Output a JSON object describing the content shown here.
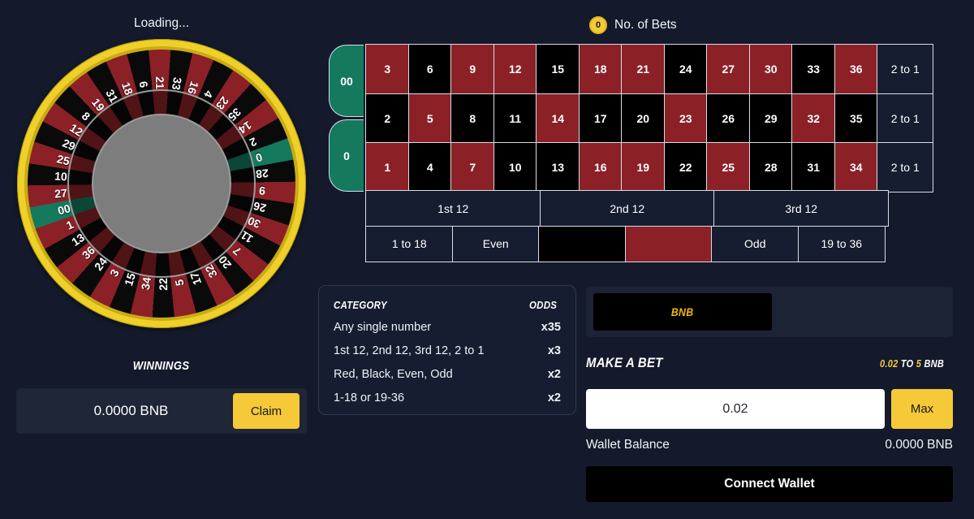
{
  "status": {
    "loading_text": "Loading..."
  },
  "bets_badge": {
    "count": "0",
    "label": "No. of Bets"
  },
  "board": {
    "zeros": [
      {
        "label": "00"
      },
      {
        "label": "0"
      }
    ],
    "rows": [
      {
        "cells": [
          {
            "label": "3",
            "color": "red"
          },
          {
            "label": "6",
            "color": "black"
          },
          {
            "label": "9",
            "color": "red"
          },
          {
            "label": "12",
            "color": "red"
          },
          {
            "label": "15",
            "color": "black"
          },
          {
            "label": "18",
            "color": "red"
          },
          {
            "label": "21",
            "color": "red"
          },
          {
            "label": "24",
            "color": "black"
          },
          {
            "label": "27",
            "color": "red"
          },
          {
            "label": "30",
            "color": "red"
          },
          {
            "label": "33",
            "color": "black"
          },
          {
            "label": "36",
            "color": "red"
          }
        ],
        "column_bet": "2 to 1"
      },
      {
        "cells": [
          {
            "label": "2",
            "color": "black"
          },
          {
            "label": "5",
            "color": "red"
          },
          {
            "label": "8",
            "color": "black"
          },
          {
            "label": "11",
            "color": "black"
          },
          {
            "label": "14",
            "color": "red"
          },
          {
            "label": "17",
            "color": "black"
          },
          {
            "label": "20",
            "color": "black"
          },
          {
            "label": "23",
            "color": "red"
          },
          {
            "label": "26",
            "color": "black"
          },
          {
            "label": "29",
            "color": "black"
          },
          {
            "label": "32",
            "color": "red"
          },
          {
            "label": "35",
            "color": "black"
          }
        ],
        "column_bet": "2 to 1"
      },
      {
        "cells": [
          {
            "label": "1",
            "color": "red"
          },
          {
            "label": "4",
            "color": "black"
          },
          {
            "label": "7",
            "color": "red"
          },
          {
            "label": "10",
            "color": "black"
          },
          {
            "label": "13",
            "color": "black"
          },
          {
            "label": "16",
            "color": "red"
          },
          {
            "label": "19",
            "color": "red"
          },
          {
            "label": "22",
            "color": "black"
          },
          {
            "label": "25",
            "color": "red"
          },
          {
            "label": "28",
            "color": "black"
          },
          {
            "label": "31",
            "color": "black"
          },
          {
            "label": "34",
            "color": "red"
          }
        ],
        "column_bet": "2 to 1"
      }
    ],
    "dozens": [
      "1st 12",
      "2nd 12",
      "3rd 12"
    ],
    "outside": [
      {
        "label": "1 to 18",
        "swatch": "none"
      },
      {
        "label": "Even",
        "swatch": "none"
      },
      {
        "label": "",
        "swatch": "black"
      },
      {
        "label": "",
        "swatch": "red"
      },
      {
        "label": "Odd",
        "swatch": "none"
      },
      {
        "label": "19 to 36",
        "swatch": "none"
      }
    ]
  },
  "odds": {
    "header": {
      "category": "CATEGORY",
      "odds": "ODDS"
    },
    "rows": [
      {
        "category": "Any single number",
        "value": "x35"
      },
      {
        "category": "1st 12, 2nd 12, 3rd 12, 2 to 1",
        "value": "x3"
      },
      {
        "category": "Red, Black, Even, Odd",
        "value": "x2"
      },
      {
        "category": "1-18 or 19-36",
        "value": "x2"
      }
    ]
  },
  "winnings": {
    "title": "WINNINGS",
    "amount": "0.0000 BNB",
    "claim_label": "Claim"
  },
  "token": {
    "symbol": "BNB"
  },
  "make_bet": {
    "title": "MAKE A BET",
    "limit_min": "0.02",
    "limit_to": "TO",
    "limit_max": "5",
    "limit_unit": "BNB",
    "input_value": "0.02",
    "input_placeholder": "0.02",
    "max_label": "Max"
  },
  "wallet": {
    "balance_label": "Wallet Balance",
    "balance_value": "0.0000 BNB",
    "connect_label": "Connect Wallet"
  },
  "wheel": {
    "sequence": [
      "0",
      "28",
      "9",
      "26",
      "30",
      "11",
      "7",
      "20",
      "32",
      "17",
      "5",
      "22",
      "34",
      "15",
      "3",
      "24",
      "36",
      "13",
      "1",
      "00",
      "27",
      "10",
      "25",
      "29",
      "12",
      "8",
      "19",
      "31",
      "18",
      "6",
      "21",
      "33",
      "16",
      "4",
      "23",
      "35",
      "14",
      "2"
    ],
    "colors": [
      "green",
      "black",
      "red",
      "black",
      "red",
      "black",
      "red",
      "black",
      "red",
      "black",
      "red",
      "black",
      "red",
      "black",
      "red",
      "black",
      "red",
      "black",
      "red",
      "green",
      "red",
      "black",
      "red",
      "black",
      "red",
      "black",
      "red",
      "black",
      "red",
      "black",
      "red",
      "black",
      "red",
      "black",
      "red",
      "black",
      "red",
      "black"
    ],
    "rim_color": "#efd028",
    "red_color": "#8b2127",
    "black_color": "#0a0a0a",
    "green_color": "#15795d",
    "hub_color": "#7d7d7d"
  }
}
